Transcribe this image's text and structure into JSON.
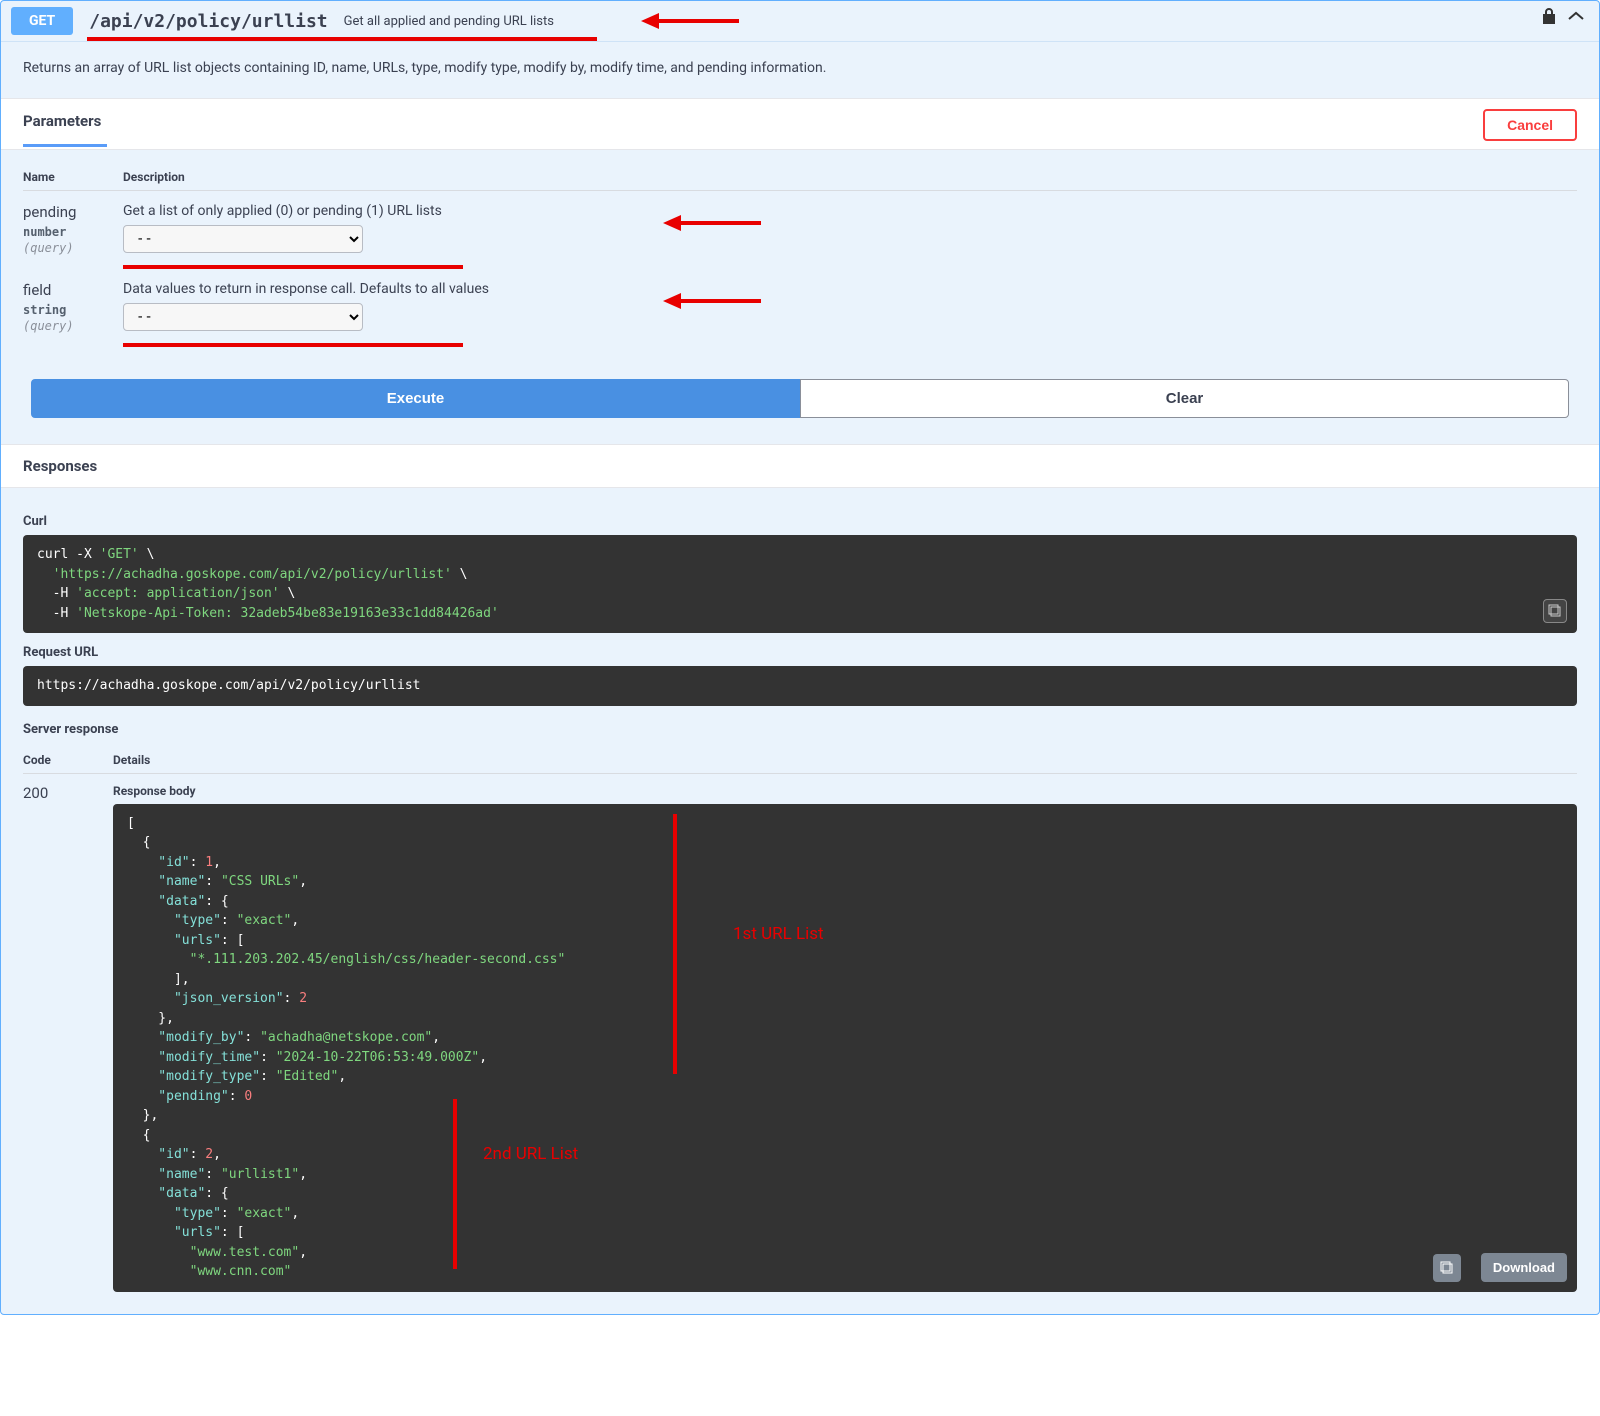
{
  "op": {
    "method": "GET",
    "path": "/api/v2/policy/urllist",
    "summary": "Get all applied and pending URL lists",
    "description": "Returns an array of URL list objects containing ID, name, URLs, type, modify type, modify by, modify time, and pending information."
  },
  "sections": {
    "parameters": "Parameters",
    "responses": "Responses"
  },
  "buttons": {
    "cancel": "Cancel",
    "execute": "Execute",
    "clear": "Clear",
    "download": "Download"
  },
  "params": {
    "head_name": "Name",
    "head_desc": "Description",
    "items": [
      {
        "name": "pending",
        "type": "number",
        "in": "(query)",
        "desc": "Get a list of only applied (0) or pending (1) URL lists",
        "value": "--"
      },
      {
        "name": "field",
        "type": "string",
        "in": "(query)",
        "desc": "Data values to return in response call. Defaults to all values",
        "value": "--"
      }
    ]
  },
  "resp": {
    "curl_label": "Curl",
    "curl_l1a": "curl -X ",
    "curl_l1b": "'GET'",
    "curl_l1c": " \\",
    "curl_l2": "  'https://achadha.goskope.com/api/v2/policy/urllist'",
    "curl_l2b": " \\",
    "curl_l3a": "  -H ",
    "curl_l3b": "'accept: application/json'",
    "curl_l3c": " \\",
    "curl_l4a": "  -H ",
    "curl_l4b": "'Netskope-Api-Token: 32adeb54be83e19163e33c1dd84426ad'",
    "req_url_label": "Request URL",
    "req_url": "https://achadha.goskope.com/api/v2/policy/urllist",
    "server_resp": "Server response",
    "code_h": "Code",
    "details_h": "Details",
    "code": "200",
    "resp_body_label": "Response body",
    "body": {
      "l0": "[",
      "l1": "  {",
      "l2k": "    \"id\"",
      "l2c": ": ",
      "l2v": "1",
      "l2e": ",",
      "l3k": "    \"name\"",
      "l3c": ": ",
      "l3v": "\"CSS URLs\"",
      "l3e": ",",
      "l4k": "    \"data\"",
      "l4c": ": {",
      "l5k": "      \"type\"",
      "l5c": ": ",
      "l5v": "\"exact\"",
      "l5e": ",",
      "l6k": "      \"urls\"",
      "l6c": ": [",
      "l7v": "        \"*.111.203.202.45/english/css/header-second.css\"",
      "l8": "      ],",
      "l9k": "      \"json_version\"",
      "l9c": ": ",
      "l9v": "2",
      "l10": "    },",
      "l11k": "    \"modify_by\"",
      "l11c": ": ",
      "l11v": "\"achadha@netskope.com\"",
      "l11e": ",",
      "l12k": "    \"modify_time\"",
      "l12c": ": ",
      "l12v": "\"2024-10-22T06:53:49.000Z\"",
      "l12e": ",",
      "l13k": "    \"modify_type\"",
      "l13c": ": ",
      "l13v": "\"Edited\"",
      "l13e": ",",
      "l14k": "    \"pending\"",
      "l14c": ": ",
      "l14v": "0",
      "l15": "  },",
      "l16": "  {",
      "l17k": "    \"id\"",
      "l17c": ": ",
      "l17v": "2",
      "l17e": ",",
      "l18k": "    \"name\"",
      "l18c": ": ",
      "l18v": "\"urllist1\"",
      "l18e": ",",
      "l19k": "    \"data\"",
      "l19c": ": {",
      "l20k": "      \"type\"",
      "l20c": ": ",
      "l20v": "\"exact\"",
      "l20e": ",",
      "l21k": "      \"urls\"",
      "l21c": ": [",
      "l22v": "        \"www.test.com\"",
      "l22e": ",",
      "l23v": "        \"www.cnn.com\"",
      "l23e": ""
    }
  },
  "annotations": {
    "first": "1st URL List",
    "second": "2nd URL List"
  }
}
